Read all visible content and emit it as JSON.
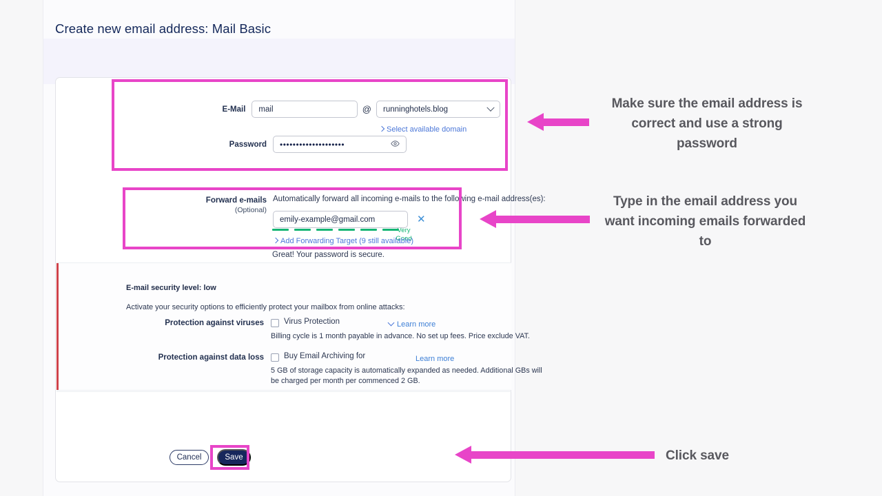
{
  "page": {
    "title": "Create new email address: Mail Basic"
  },
  "form": {
    "email": {
      "label": "E-Mail",
      "value": "mail",
      "at_symbol": "@",
      "domain_value": "runninghotels.blog",
      "select_domain_link": "Select available domain"
    },
    "password": {
      "label": "Password",
      "value": "••••••••••••••••••••",
      "reveal_icon": "eye-icon",
      "strength_bars": 6,
      "strength_label": "Very Good",
      "strength_color": "#15b574",
      "note": "Great! Your password is secure."
    },
    "forward": {
      "label": "Forward e-mails",
      "sub_label": "(Optional)",
      "description": "Automatically forward all incoming e-mails to the following e-mail address(es):",
      "address": "emily-example@gmail.com",
      "remove_icon": "close-icon",
      "add_link": "Add Forwarding Target (9 still available)"
    }
  },
  "security": {
    "title": "E-mail security level: low",
    "subtitle": "Activate your security options to efficiently protect your mailbox from online attacks:",
    "accent_color": "#d0434b",
    "options": [
      {
        "label": "Protection against viruses",
        "checkbox_label": "Virus Protection",
        "checked": false,
        "learn_more": "Learn more",
        "fineprint": "Billing cycle is 1 month payable in advance. No set up fees. Price exclude VAT."
      },
      {
        "label": "Protection against data loss",
        "checkbox_label": "Buy Email Archiving for",
        "checked": false,
        "learn_more": "Learn more",
        "fineprint_line1": "5 GB of storage capacity is automatically expanded as needed. Additional GBs will be",
        "fineprint_line2": "charged           per month per commenced 2 GB."
      }
    ]
  },
  "footer": {
    "cancel_label": "Cancel",
    "save_label": "Save"
  },
  "annotations": {
    "highlight_color": "#e845c8",
    "text_color": "#58585e",
    "credentials": "Make sure the email address is correct and use a strong password",
    "forwarding": "Type in the email address you want incoming emails forwarded to",
    "save": "Click save"
  }
}
